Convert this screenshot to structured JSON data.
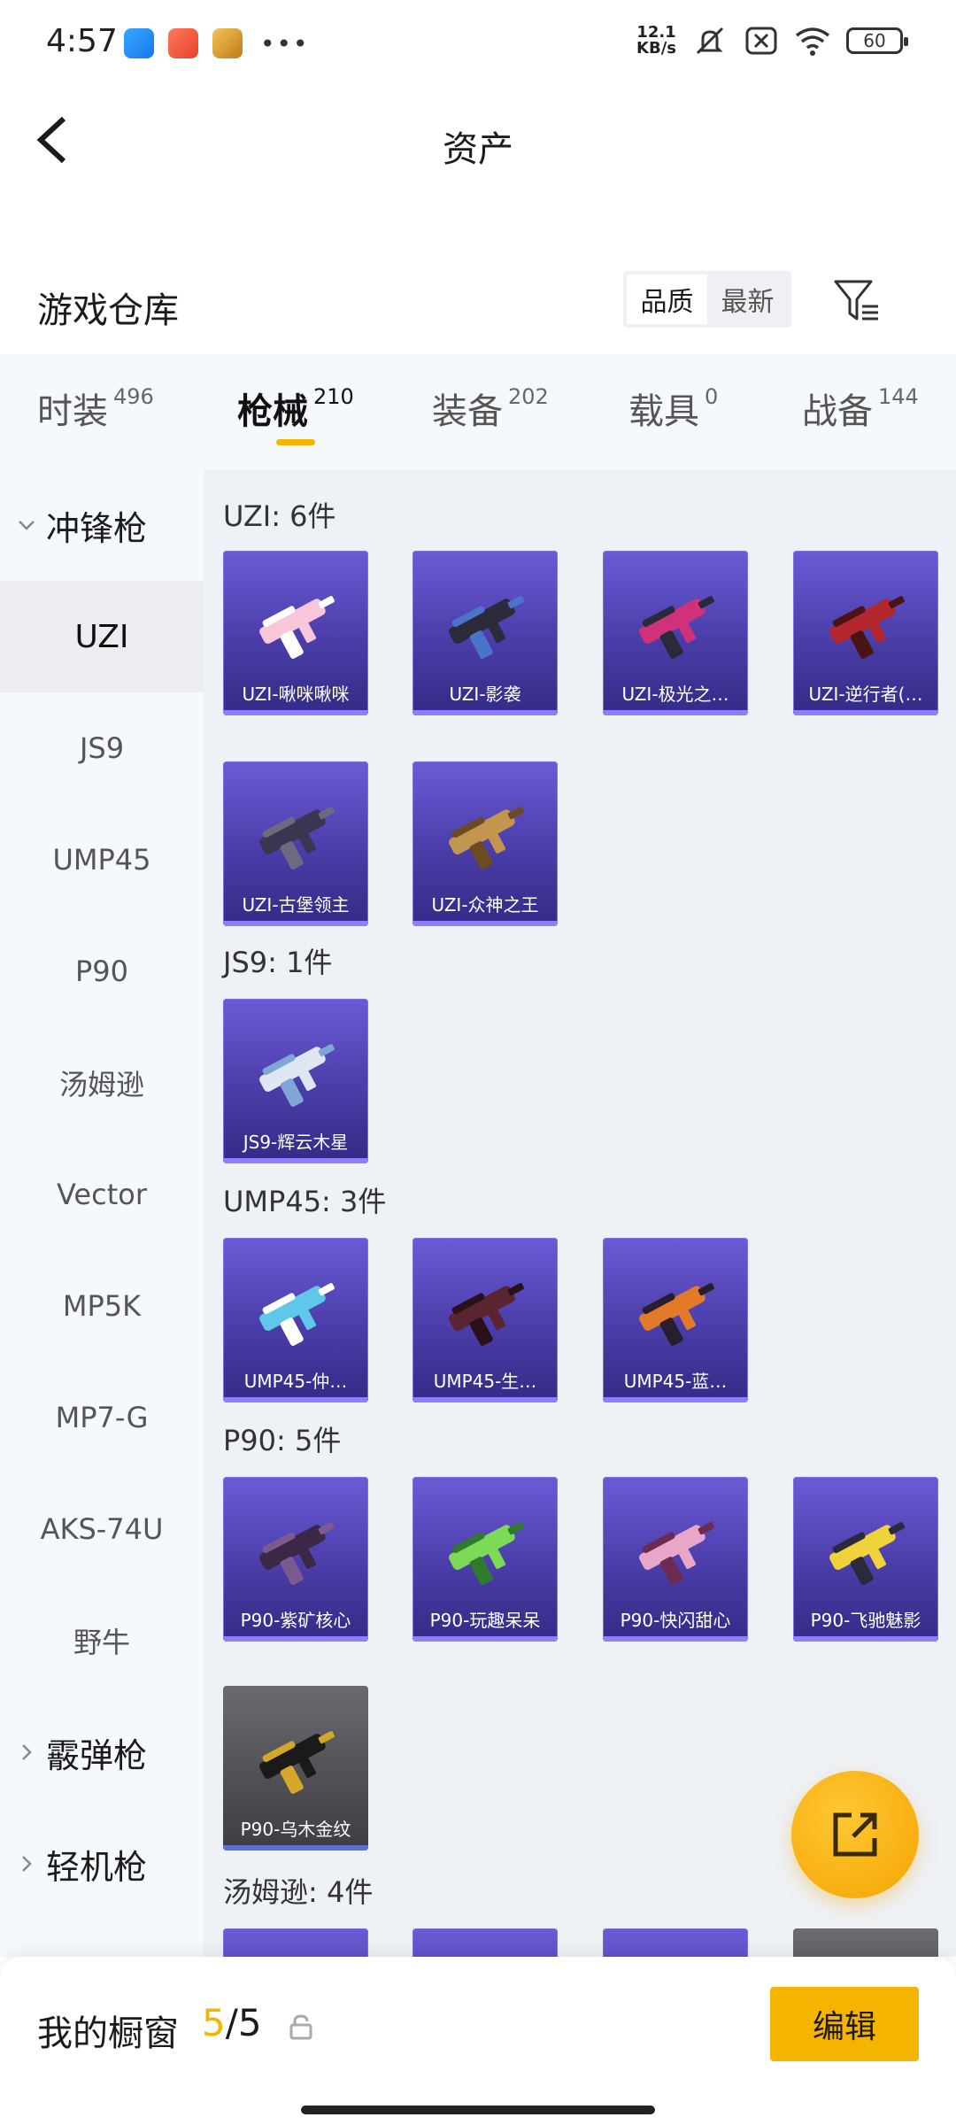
{
  "status": {
    "time": "4:57",
    "net_speed_value": "12.1",
    "net_speed_unit": "KB/s",
    "battery": "60"
  },
  "header": {
    "title": "资产"
  },
  "warehouse": {
    "title": "游戏仓库",
    "sort_options": [
      "品质",
      "最新"
    ],
    "active_sort": "品质"
  },
  "tabs": [
    {
      "label": "时装",
      "count": "496"
    },
    {
      "label": "枪械",
      "count": "210"
    },
    {
      "label": "装备",
      "count": "202"
    },
    {
      "label": "载具",
      "count": "0"
    },
    {
      "label": "战备",
      "count": "144"
    }
  ],
  "sidebar": {
    "group_open": "冲锋枪",
    "items": [
      "UZI",
      "JS9",
      "UMP45",
      "P90",
      "汤姆逊",
      "Vector",
      "MP5K",
      "MP7-G",
      "AKS-74U",
      "野牛"
    ],
    "groups_closed": [
      "霰弹枪",
      "轻机枪"
    ]
  },
  "sections": [
    {
      "title": "UZI: 6件",
      "items": [
        "UZI-啾咪啾咪",
        "UZI-影袭",
        "UZI-极光之…",
        "UZI-逆行者(…",
        "UZI-古堡领主",
        "UZI-众神之王"
      ]
    },
    {
      "title": "JS9: 1件",
      "items": [
        "JS9-辉云木星"
      ]
    },
    {
      "title": "UMP45: 3件",
      "items": [
        "UMP45-仲…",
        "UMP45-生…",
        "UMP45-蓝…"
      ]
    },
    {
      "title": "P90: 5件",
      "items": [
        "P90-紫矿核心",
        "P90-玩趣呆呆",
        "P90-快闪甜心",
        "P90-飞驰魅影",
        "P90-乌木金纹"
      ]
    },
    {
      "title": "汤姆逊: 4件",
      "items": []
    }
  ],
  "bottom": {
    "showcase_label": "我的橱窗",
    "showcase_current": "5",
    "showcase_sep": "/",
    "showcase_total": "5",
    "edit_label": "编辑"
  }
}
